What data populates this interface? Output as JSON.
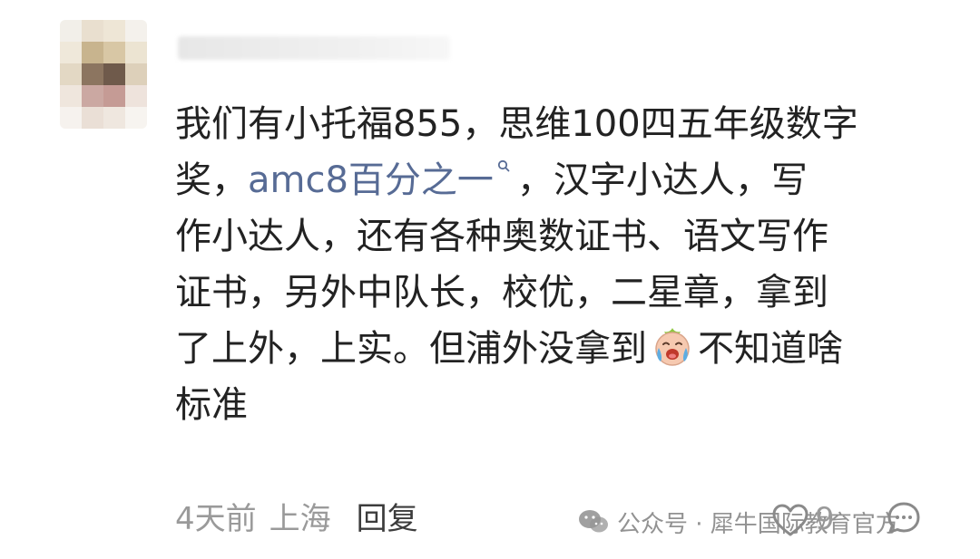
{
  "comment": {
    "lines": [
      {
        "text": "我们有小托福855，思维100四五年级数字"
      },
      {
        "before": "奖，",
        "link": "amc8百分之一",
        "after": "，汉字小达人，写"
      },
      {
        "text": "作小达人，还有各种奥数证书、语文写作"
      },
      {
        "text": "证书，另外中队长，校优，二星章，拿到"
      },
      {
        "before": "了上外，上实。但浦外没拿到",
        "after": "不知道啥"
      },
      {
        "text": "标准"
      }
    ],
    "emoji": "crying-face-emoji"
  },
  "meta": {
    "time": "4天前",
    "location": "上海",
    "reply_label": "回复",
    "like_count": "9"
  },
  "watermark": {
    "text": "公众号 · 犀牛国际教育官方"
  },
  "icons": {
    "like": "heart-outline-icon",
    "comment": "comment-bubble-icon",
    "search": "search-icon",
    "watermark": "wechat-icon"
  },
  "colors": {
    "text": "#222222",
    "link": "#576b95",
    "meta": "#9a9a9a"
  }
}
